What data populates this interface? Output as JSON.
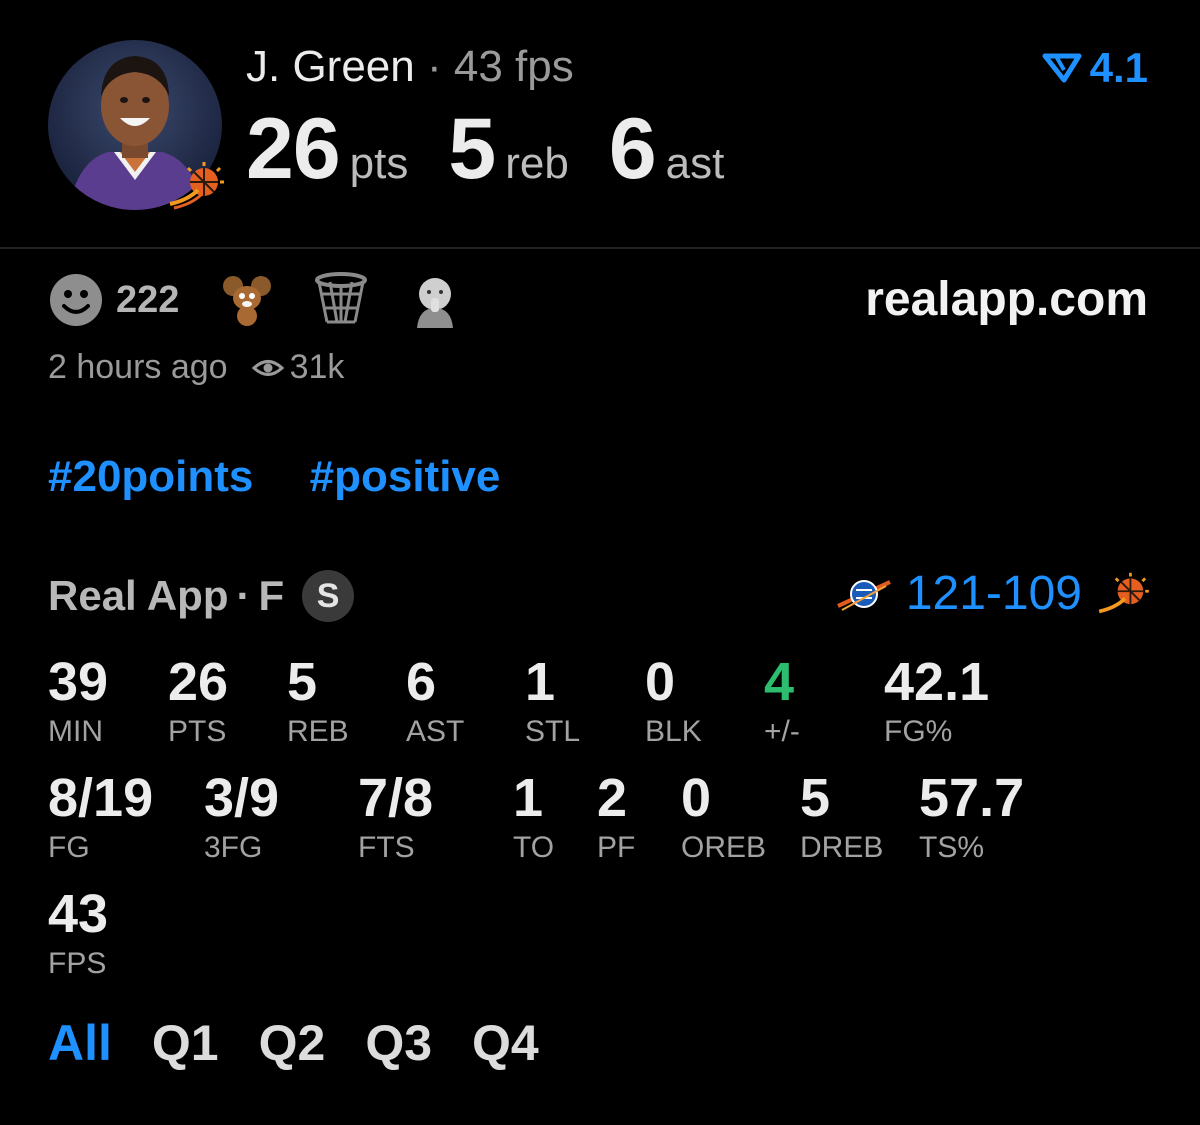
{
  "player": {
    "name": "J. Green",
    "separator": "·",
    "fps_label": "43 fps",
    "pts": "26",
    "pts_unit": "pts",
    "reb": "5",
    "reb_unit": "reb",
    "ast": "6",
    "ast_unit": "ast",
    "rating": "4.1"
  },
  "social": {
    "reaction_count": "222",
    "site": "realapp.com",
    "time_ago": "2 hours ago",
    "views": "31k"
  },
  "tags": [
    "#20points",
    "#positive"
  ],
  "game": {
    "source": "Real App",
    "separator": "·",
    "status": "F",
    "badge": "S",
    "home_score": "121",
    "dash": "-",
    "away_score": "109"
  },
  "stats": {
    "row1": [
      {
        "value": "39",
        "label": "MIN"
      },
      {
        "value": "26",
        "label": "PTS"
      },
      {
        "value": "5",
        "label": "REB"
      },
      {
        "value": "6",
        "label": "AST"
      },
      {
        "value": "1",
        "label": "STL"
      },
      {
        "value": "0",
        "label": "BLK"
      },
      {
        "value": "4",
        "label": "+/-"
      },
      {
        "value": "42.1",
        "label": "FG%"
      }
    ],
    "row2": [
      {
        "value": "8/19",
        "label": "FG"
      },
      {
        "value": "3/9",
        "label": "3FG"
      },
      {
        "value": "7/8",
        "label": "FTS"
      },
      {
        "value": "1",
        "label": "TO"
      },
      {
        "value": "2",
        "label": "PF"
      },
      {
        "value": "0",
        "label": "OREB"
      },
      {
        "value": "5",
        "label": "DREB"
      },
      {
        "value": "57.7",
        "label": "TS%"
      }
    ],
    "row3": [
      {
        "value": "43",
        "label": "FPS"
      }
    ]
  },
  "quarters": [
    "All",
    "Q1",
    "Q2",
    "Q3",
    "Q4"
  ],
  "colors": {
    "accent": "#1e90ff",
    "positive": "#2dbd6e",
    "background": "#000000"
  },
  "icons": [
    "avatar-photo",
    "suns-logo-icon",
    "real-rating-icon",
    "smiley-icon",
    "mouse-sticker-icon",
    "basketball-net-icon",
    "baby-sticker-icon",
    "eye-icon",
    "thunder-logo-icon"
  ]
}
